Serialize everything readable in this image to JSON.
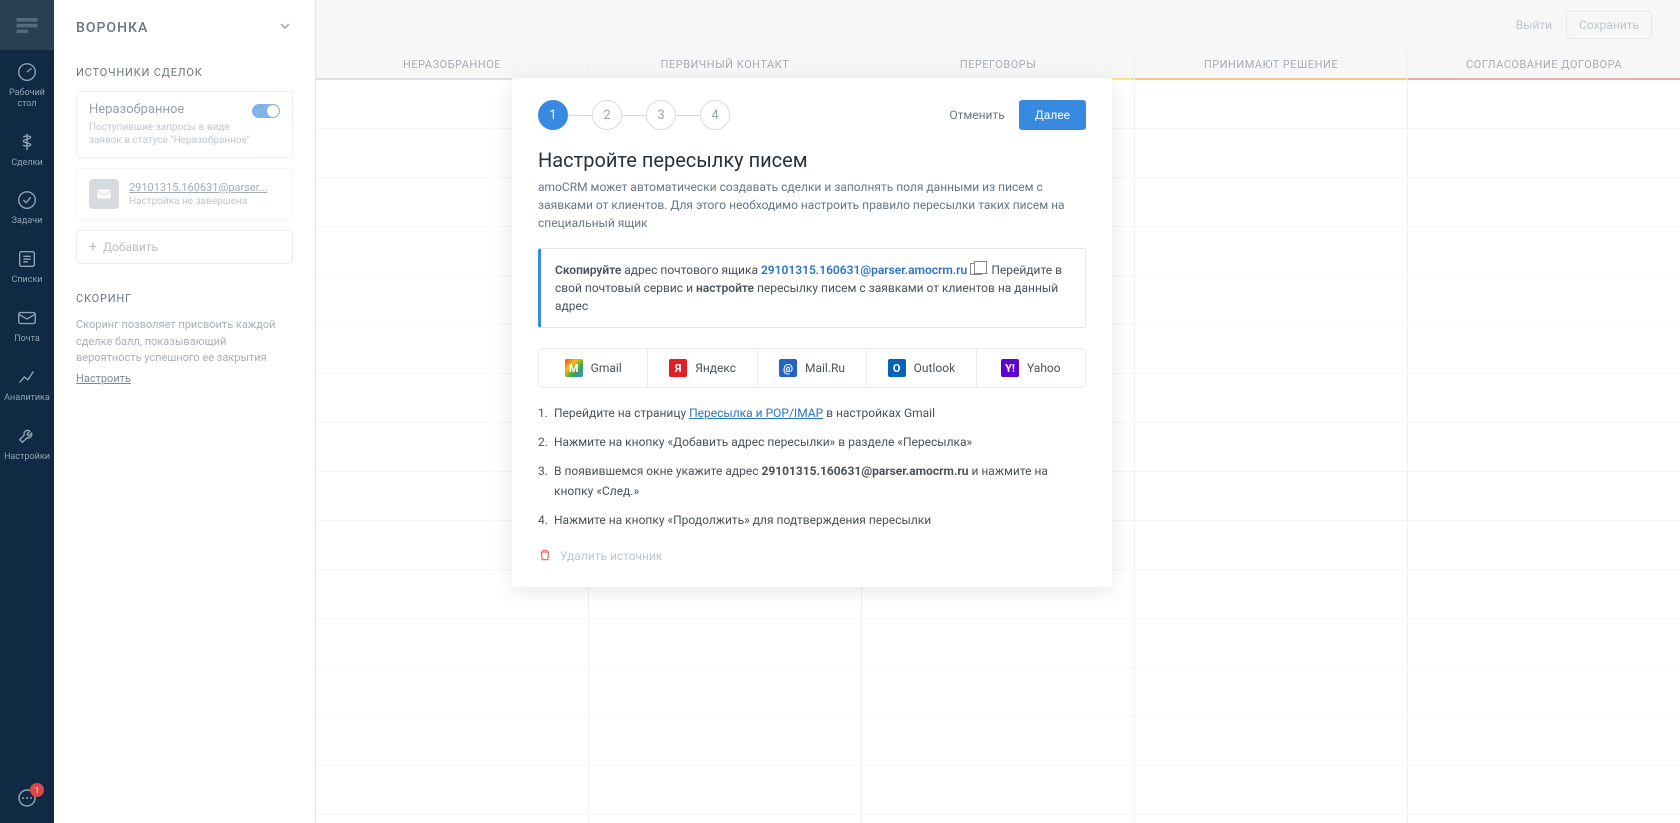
{
  "nav": {
    "items": [
      {
        "label": "Рабочий\nстол"
      },
      {
        "label": "Сделки"
      },
      {
        "label": "Задачи"
      },
      {
        "label": "Списки"
      },
      {
        "label": "Почта"
      },
      {
        "label": "Аналитика"
      },
      {
        "label": "Настройки"
      }
    ],
    "badge": "1"
  },
  "sidebar": {
    "title": "ВОРОНКА",
    "sources_title": "ИСТОЧНИКИ СДЕЛОК",
    "unsorted": {
      "title": "Неразобранное",
      "desc": "Поступившие запросы в виде заявок в статусе \"Неразобранное\""
    },
    "email_source": {
      "address": "29101315.160631@parser...",
      "status": "Настройка не завершена"
    },
    "add_label": "Добавить",
    "scoring_title": "СКОРИНГ",
    "scoring_desc": "Скоринг позволяет присвоить каждой сделке балл, показывающий вероятность успешного ее закрытия",
    "scoring_link": "Настроить"
  },
  "top": {
    "logout": "Выйти",
    "save": "Сохранить"
  },
  "pipeline": {
    "cols": [
      "НЕРАЗОБРАННОЕ",
      "ПЕРВИЧНЫЙ КОНТАКТ",
      "ПЕРЕГОВОРЫ",
      "ПРИНИМАЮТ РЕШЕНИЕ",
      "СОГЛАСОВАНИЕ ДОГОВОРА"
    ]
  },
  "modal": {
    "steps": [
      "1",
      "2",
      "3",
      "4"
    ],
    "cancel": "Отменить",
    "next": "Далее",
    "title": "Настройте пересылку писем",
    "desc": "amoCRM может автоматически создавать сделки и заполнять поля данными из писем с заявками от клиентов. Для этого необходимо настроить правило пересылки таких писем на специальный ящик",
    "info_copy": "Скопируйте",
    "info_text1": " адрес почтового ящика ",
    "info_email": "29101315.160631@parser.amocrm.ru",
    "info_text2": ". Перейдите в свой почтовый сервис и ",
    "info_setup": "настройте",
    "info_text3": " пересылку писем с заявками от клиентов на данный адрес",
    "providers": [
      {
        "name": "Gmail"
      },
      {
        "name": "Яндекс"
      },
      {
        "name": "Mail.Ru"
      },
      {
        "name": "Outlook"
      },
      {
        "name": "Yahoo"
      }
    ],
    "instr": {
      "s1a": "Перейдите на страницу ",
      "s1link": "Пересылка и POP/IMAP",
      "s1b": " в настройках Gmail",
      "s2": "Нажмите на кнопку «Добавить адрес пересылки» в разделе «Пересылка»",
      "s3a": "В появившемся окне укажите адрес ",
      "s3email": "29101315.160631@parser.amocrm.ru",
      "s3b": " и нажмите на кнопку «След.»",
      "s4": "Нажмите на кнопку «Продолжить» для подтверждения пересылки"
    },
    "delete": "Удалить источник"
  }
}
